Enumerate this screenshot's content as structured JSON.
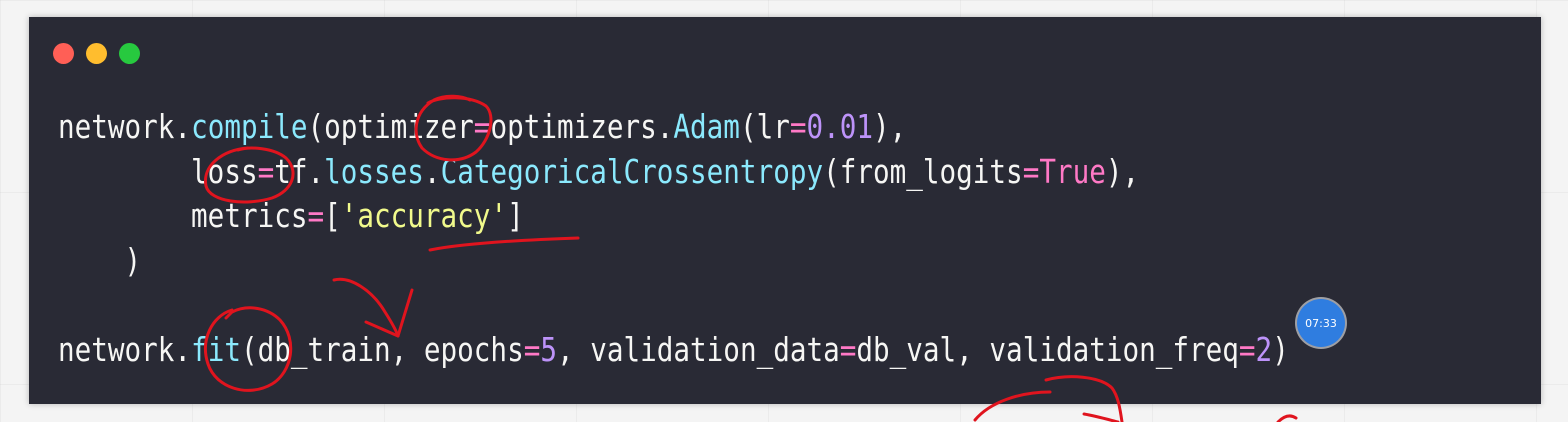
{
  "window": {
    "buttons": [
      {
        "name": "close-dot",
        "color": "#ff5f56"
      },
      {
        "name": "minimize-dot",
        "color": "#ffbd2e"
      },
      {
        "name": "zoom-dot",
        "color": "#27c93f"
      }
    ]
  },
  "colors": {
    "default": "#f6f6f4",
    "method": "#8be9fd",
    "class": "#8be9fd",
    "keyword_arg": "#f6f6f4",
    "operator": "#ff79c6",
    "number": "#bd93f9",
    "constant": "#ff79c6",
    "string": "#f1fa8c",
    "annotation": "#e0141e"
  },
  "code": {
    "lines": [
      [
        {
          "t": "network.",
          "c": "default"
        },
        {
          "t": "compile",
          "c": "method"
        },
        {
          "t": "(optimizer",
          "c": "default"
        },
        {
          "t": "=",
          "c": "operator"
        },
        {
          "t": "optimizers.",
          "c": "default"
        },
        {
          "t": "Adam",
          "c": "class"
        },
        {
          "t": "(lr",
          "c": "default"
        },
        {
          "t": "=",
          "c": "operator"
        },
        {
          "t": "0.01",
          "c": "number"
        },
        {
          "t": "),",
          "c": "default"
        }
      ],
      [
        {
          "t": "        loss",
          "c": "default"
        },
        {
          "t": "=",
          "c": "operator"
        },
        {
          "t": "tf.",
          "c": "default"
        },
        {
          "t": "losses",
          "c": "method"
        },
        {
          "t": ".",
          "c": "default"
        },
        {
          "t": "CategoricalCrossentropy",
          "c": "class"
        },
        {
          "t": "(from_logits",
          "c": "default"
        },
        {
          "t": "=",
          "c": "operator"
        },
        {
          "t": "True",
          "c": "constant"
        },
        {
          "t": "),",
          "c": "default"
        }
      ],
      [
        {
          "t": "        metrics",
          "c": "default"
        },
        {
          "t": "=",
          "c": "operator"
        },
        {
          "t": "[",
          "c": "default"
        },
        {
          "t": "'accuracy'",
          "c": "string"
        },
        {
          "t": "]",
          "c": "default"
        }
      ],
      [
        {
          "t": "    )",
          "c": "default"
        }
      ],
      [],
      [
        {
          "t": "network.",
          "c": "default"
        },
        {
          "t": "fit",
          "c": "method"
        },
        {
          "t": "(db_train, epochs",
          "c": "default"
        },
        {
          "t": "=",
          "c": "operator"
        },
        {
          "t": "5",
          "c": "number"
        },
        {
          "t": ", validation_data",
          "c": "default"
        },
        {
          "t": "=",
          "c": "operator"
        },
        {
          "t": "db_val, validation_freq",
          "c": "default"
        },
        {
          "t": "=",
          "c": "operator"
        },
        {
          "t": "2",
          "c": "number"
        },
        {
          "t": ")",
          "c": "default"
        }
      ]
    ]
  },
  "timer": {
    "label": "07:33"
  }
}
